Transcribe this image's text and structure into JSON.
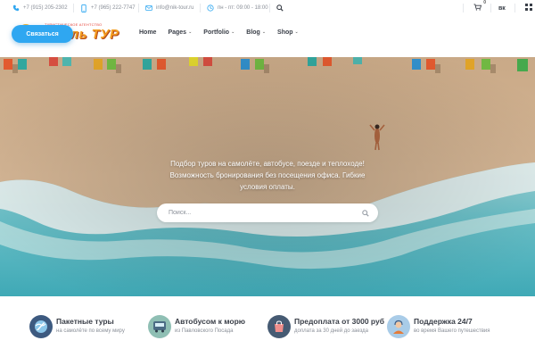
{
  "topbar": {
    "phone1": "+7 (915) 205-2302",
    "phone2": "+7 (965) 222-7747",
    "email": "info@nik-tour.ru",
    "hours": "пн - пт: 09:00 - 18:00",
    "cart_count": "0",
    "social": "вк"
  },
  "logo": {
    "tagline": "ТУРИСТИЧЕСКОЕ АГЕНТСТВО",
    "name": "Николь ТУР"
  },
  "nav": {
    "items": [
      {
        "label": "Home",
        "has_caret": false
      },
      {
        "label": "Pages",
        "has_caret": true
      },
      {
        "label": "Portfolio",
        "has_caret": true
      },
      {
        "label": "Blog",
        "has_caret": true
      },
      {
        "label": "Shop",
        "has_caret": true
      }
    ]
  },
  "cta": {
    "label": "Связаться"
  },
  "hero": {
    "line1": "Подбор туров на самолёте, автобусе, поезде и теплоходе!",
    "line2": "Возможность бронирования без посещения офиса. Гибкие",
    "line3": "условия оплаты.",
    "search_placeholder": "Поиск..."
  },
  "features": [
    {
      "title": "Пакетные туры",
      "subtitle": "на самолёте по всему миру",
      "icon": "globe-plane-icon"
    },
    {
      "title": "Автобусом к морю",
      "subtitle": "из Павловского Посада",
      "icon": "bus-icon"
    },
    {
      "title": "Предоплата от 3000 руб",
      "subtitle": "доплата за 30 дней до заезда",
      "icon": "shopping-bag-icon"
    },
    {
      "title": "Поддержка 24/7",
      "subtitle": "во время Вашего путешествия",
      "icon": "support-agent-icon"
    }
  ],
  "colors": {
    "accent": "#2fa7f1",
    "icon_blue": "#5b9bd5",
    "logo_orange": "#f39c1e"
  }
}
